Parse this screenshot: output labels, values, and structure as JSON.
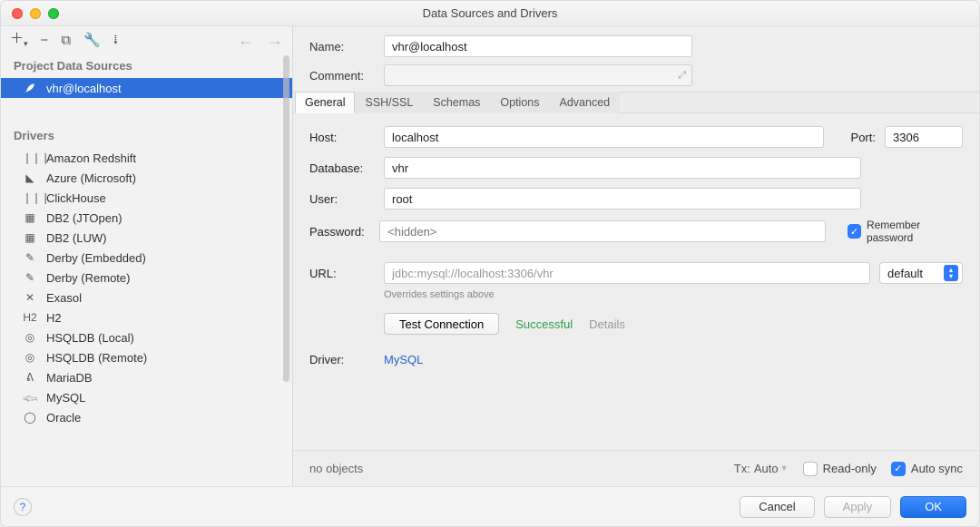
{
  "window": {
    "title": "Data Sources and Drivers"
  },
  "sidebar": {
    "sections": {
      "project": "Project Data Sources",
      "drivers": "Drivers"
    },
    "data_sources": [
      {
        "label": "vhr@localhost",
        "icon": "feather-icon",
        "selected": true
      }
    ],
    "drivers": [
      {
        "label": "Amazon Redshift",
        "glyph": "❘❘❘"
      },
      {
        "label": "Azure (Microsoft)",
        "glyph": "◣"
      },
      {
        "label": "ClickHouse",
        "glyph": "❘❘❘"
      },
      {
        "label": "DB2 (JTOpen)",
        "glyph": "▦"
      },
      {
        "label": "DB2 (LUW)",
        "glyph": "▦"
      },
      {
        "label": "Derby (Embedded)",
        "glyph": "✎"
      },
      {
        "label": "Derby (Remote)",
        "glyph": "✎"
      },
      {
        "label": "Exasol",
        "glyph": "✕"
      },
      {
        "label": "H2",
        "glyph": "H2"
      },
      {
        "label": "HSQLDB (Local)",
        "glyph": "◎"
      },
      {
        "label": "HSQLDB (Remote)",
        "glyph": "◎"
      },
      {
        "label": "MariaDB",
        "glyph": "ᕕ"
      },
      {
        "label": "MySQL",
        "glyph": "𓆟"
      },
      {
        "label": "Oracle",
        "glyph": "◯"
      }
    ]
  },
  "form": {
    "name_label": "Name:",
    "name_value": "vhr@localhost",
    "comment_label": "Comment:",
    "tabs": [
      {
        "label": "General",
        "active": true
      },
      {
        "label": "SSH/SSL",
        "active": false
      },
      {
        "label": "Schemas",
        "active": false
      },
      {
        "label": "Options",
        "active": false
      },
      {
        "label": "Advanced",
        "active": false
      }
    ],
    "host_label": "Host:",
    "host_value": "localhost",
    "port_label": "Port:",
    "port_value": "3306",
    "database_label": "Database:",
    "database_value": "vhr",
    "user_label": "User:",
    "user_value": "root",
    "password_label": "Password:",
    "password_placeholder": "<hidden>",
    "remember_label": "Remember password",
    "url_label": "URL:",
    "url_value": "jdbc:mysql://localhost:3306/vhr",
    "url_mode": "default",
    "url_hint": "Overrides settings above",
    "test_label": "Test Connection",
    "test_status": "Successful",
    "details_label": "Details",
    "driver_label": "Driver:",
    "driver_value": "MySQL"
  },
  "status": {
    "objects": "no objects",
    "tx_label": "Tx:",
    "tx_value": "Auto",
    "read_only": "Read-only",
    "auto_sync": "Auto sync"
  },
  "footer": {
    "cancel": "Cancel",
    "apply": "Apply",
    "ok": "OK"
  }
}
